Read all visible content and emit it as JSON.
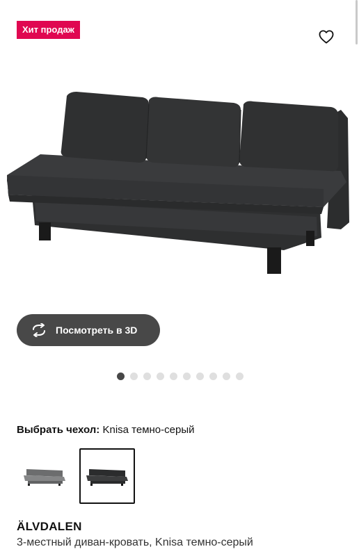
{
  "badge": {
    "label": "Хит продаж",
    "color": "#e00751"
  },
  "favorite": {
    "icon": "heart-outline-icon"
  },
  "hero_image": {
    "subject": "3-seat sofa-bed, dark grey",
    "color": "#3a3b3c"
  },
  "view_3d": {
    "label": "Посмотреть в 3D",
    "icon": "rotate-3d-icon"
  },
  "carousel": {
    "total": 10,
    "active": 1
  },
  "cover_select": {
    "label": "Выбрать чехол:",
    "value": "Knisa темно-серый"
  },
  "cover_options": [
    {
      "name": "light-grey",
      "color": "#7a7b7c",
      "selected": false
    },
    {
      "name": "dark-grey",
      "color": "#3a3b3c",
      "selected": true
    }
  ],
  "product": {
    "name": "ÄLVDALEN",
    "description": "3-местный диван-кровать, Knisa темно-серый"
  }
}
